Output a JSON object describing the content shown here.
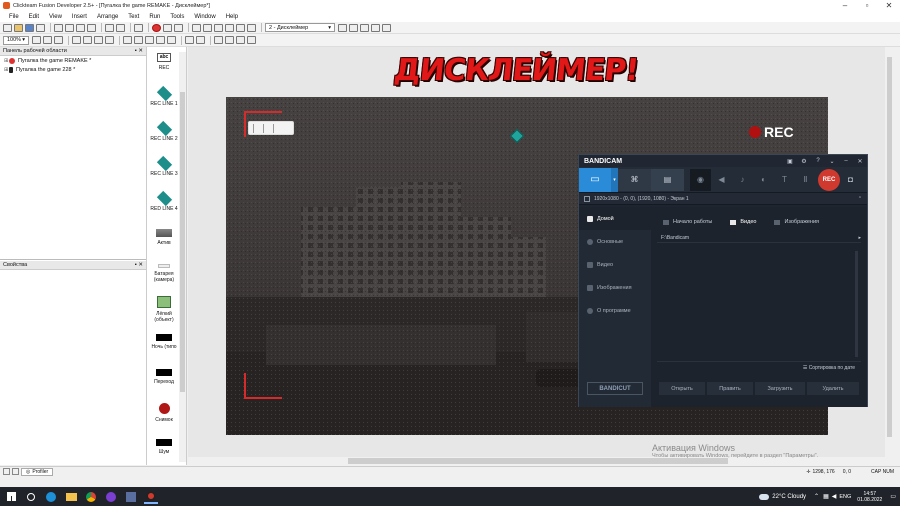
{
  "window": {
    "title": "Clickteam Fusion Developer 2.5+ - [Пугалка the game REMAKE - Дисклеймер*]"
  },
  "menu": [
    "File",
    "Edit",
    "View",
    "Insert",
    "Arrange",
    "Text",
    "Run",
    "Tools",
    "Window",
    "Help"
  ],
  "toolbar": {
    "frame_select": "2 - Дисклеймер",
    "zoom": "100%"
  },
  "workspace_panel": {
    "title": "Панель рабочей области",
    "items": [
      {
        "label": "Пугалка the game REMAKE *"
      },
      {
        "label": "Пугалка the game 228 *"
      }
    ]
  },
  "properties_panel": {
    "title": "Свойства"
  },
  "objects": [
    {
      "label": "REC",
      "icon": "abc-icon"
    },
    {
      "label": "REC LINE 1",
      "icon": "diamond-icon"
    },
    {
      "label": "REC LINE 2",
      "icon": "diamond-icon"
    },
    {
      "label": "REC LINE 3",
      "icon": "diamond-icon"
    },
    {
      "label": "RED LINE 4",
      "icon": "diamond-icon"
    },
    {
      "label": "Актив",
      "icon": "building-icon"
    },
    {
      "label": "Батарея (камера)",
      "icon": "battery-icon"
    },
    {
      "label": "Лёгкий (объект)",
      "icon": "picture-icon"
    },
    {
      "label": "Ночь (типо",
      "icon": "black-rect-icon"
    },
    {
      "label": "Переход",
      "icon": "black-rect-icon"
    },
    {
      "label": "Снимок",
      "icon": "red-circle-icon"
    },
    {
      "label": "Шум",
      "icon": "black-rect-icon"
    }
  ],
  "frame": {
    "title_text": "ДИСКЛЕЙМЕР!",
    "rec_label": "REC"
  },
  "bandicam": {
    "brand": "BANDICAM",
    "resolution": "1920x1080 - (0, 0), (1920, 1080) - Экран 1",
    "rec_button": "REC",
    "nav": [
      "Домой",
      "Основные",
      "Видео",
      "Изображения",
      "О программе"
    ],
    "tabs": [
      "Начало работы",
      "Видео",
      "Изображения"
    ],
    "path": "F:\\Bandicam",
    "sort_label": "Сортировка по дате",
    "bandicut": "BANDICUT",
    "buttons": [
      "Открыть",
      "Править",
      "Загрузить",
      "Удалить"
    ]
  },
  "statusbar": {
    "profiler": "Profiler",
    "coords": "1298, 176",
    "zoom": "0, 0",
    "cap": "CAP NUM"
  },
  "watermark": {
    "title": "Активация Windows",
    "text": "Чтобы активировать Windows, перейдите в раздел \"Параметры\"."
  },
  "taskbar": {
    "weather": "22°C Cloudy",
    "lang": "ENG",
    "time": "14:57",
    "date": "01.08.2022"
  },
  "colors": {
    "accent_red": "#d52b2b",
    "bandicam_blue": "#2a8bd8",
    "title_red": "#e01818"
  }
}
